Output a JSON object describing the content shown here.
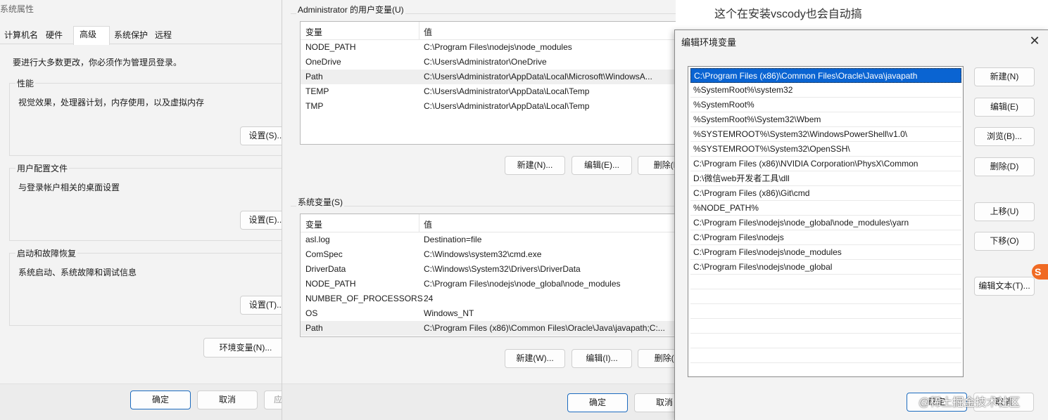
{
  "system_properties": {
    "title": "系统属性",
    "tabs": [
      "计算机名",
      "硬件",
      "高级",
      "系统保护",
      "远程"
    ],
    "admin_note": "要进行大多数更改，你必须作为管理员登录。",
    "performance": {
      "label": "性能",
      "desc": "视觉效果，处理器计划，内存使用，以及虚拟内存",
      "button": "设置(S)..."
    },
    "user_profiles": {
      "label": "用户配置文件",
      "desc": "与登录帐户相关的桌面设置",
      "button": "设置(E)..."
    },
    "startup_recovery": {
      "label": "启动和故障恢复",
      "desc": "系统启动、系统故障和调试信息",
      "button": "设置(T)..."
    },
    "env_button": "环境变量(N)...",
    "ok": "确定",
    "cancel": "取消",
    "apply_fragment": "应"
  },
  "environment_variables": {
    "user_section": "Administrator 的用户变量(U)",
    "col_var": "变量",
    "col_val": "值",
    "user_vars": [
      {
        "name": "NODE_PATH",
        "value": "C:\\Program Files\\nodejs\\node_modules"
      },
      {
        "name": "OneDrive",
        "value": "C:\\Users\\Administrator\\OneDrive"
      },
      {
        "name": "Path",
        "value": "C:\\Users\\Administrator\\AppData\\Local\\Microsoft\\WindowsA..."
      },
      {
        "name": "TEMP",
        "value": "C:\\Users\\Administrator\\AppData\\Local\\Temp"
      },
      {
        "name": "TMP",
        "value": "C:\\Users\\Administrator\\AppData\\Local\\Temp"
      }
    ],
    "user_buttons": {
      "new": "新建(N)...",
      "edit": "编辑(E)...",
      "delete": "删除(D)"
    },
    "system_section": "系统变量(S)",
    "system_vars": [
      {
        "name": "asl.log",
        "value": "Destination=file"
      },
      {
        "name": "ComSpec",
        "value": "C:\\Windows\\system32\\cmd.exe"
      },
      {
        "name": "DriverData",
        "value": "C:\\Windows\\System32\\Drivers\\DriverData"
      },
      {
        "name": "NODE_PATH",
        "value": "C:\\Program Files\\nodejs\\node_global\\node_modules"
      },
      {
        "name": "NUMBER_OF_PROCESSORS",
        "value": "24"
      },
      {
        "name": "OS",
        "value": "Windows_NT"
      },
      {
        "name": "Path",
        "value": "C:\\Program Files (x86)\\Common Files\\Oracle\\Java\\javapath;C:..."
      }
    ],
    "system_buttons": {
      "new": "新建(W)...",
      "edit": "编辑(I)...",
      "delete": "删除(L)"
    },
    "ok": "确定",
    "cancel": "取消"
  },
  "background_text": "这个在安装vscody也会自动搞",
  "edit_env_var": {
    "title": "编辑环境变量",
    "close_icon": "close-icon",
    "paths": [
      "C:\\Program Files (x86)\\Common Files\\Oracle\\Java\\javapath",
      "%SystemRoot%\\system32",
      "%SystemRoot%",
      "%SystemRoot%\\System32\\Wbem",
      "%SYSTEMROOT%\\System32\\WindowsPowerShell\\v1.0\\",
      "%SYSTEMROOT%\\System32\\OpenSSH\\",
      "C:\\Program Files (x86)\\NVIDIA Corporation\\PhysX\\Common",
      "D:\\微信web开发者工具\\dll",
      "C:\\Program Files (x86)\\Git\\cmd",
      "%NODE_PATH%",
      "C:\\Program Files\\nodejs\\node_global\\node_modules\\yarn",
      "C:\\Program Files\\nodejs",
      "C:\\Program Files\\nodejs\\node_modules",
      "C:\\Program Files\\nodejs\\node_global"
    ],
    "selected_index": 0,
    "buttons": {
      "new": "新建(N)",
      "edit": "编辑(E)",
      "browse": "浏览(B)...",
      "delete": "删除(D)",
      "move_up": "上移(U)",
      "move_down": "下移(O)",
      "edit_text": "编辑文本(T)..."
    },
    "ok": "确定",
    "cancel": "取消"
  },
  "watermark": "@稀土掘金技术社区",
  "colors": {
    "selection": "#0a64d2",
    "primary_border": "#1c6bbf",
    "window_bg": "#f3f3f3"
  }
}
